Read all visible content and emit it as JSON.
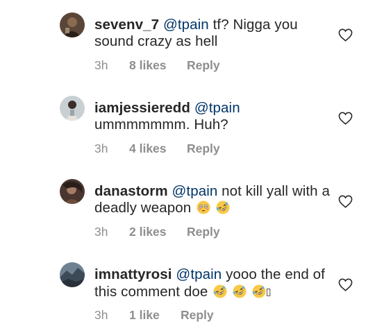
{
  "comments": [
    {
      "username": "sevenv_7",
      "mention": "@tpain",
      "text": " tf? Nigga you sound crazy as hell",
      "time": "3h",
      "likes": "8 likes",
      "reply": "Reply",
      "avatar_colors": [
        "#3a2a22",
        "#8a6a50",
        "#c9b39a"
      ]
    },
    {
      "username": "iamjessieredd",
      "mention": "@tpain",
      "text": " ummmmmmm. Huh?",
      "time": "3h",
      "likes": "4 likes",
      "reply": "Reply",
      "avatar_colors": [
        "#b9c3c9",
        "#e6e3df",
        "#3b2d28"
      ]
    },
    {
      "username": "danastorm",
      "mention": "@tpain",
      "text": " not kill yall with a deadly weapon",
      "time": "3h",
      "likes": "2 likes",
      "reply": "Reply",
      "emojis": [
        "flushed-face-emoji",
        "rolling-on-floor-laughing-emoji"
      ],
      "avatar_colors": [
        "#2b1f1c",
        "#6e4c3d",
        "#a57c65"
      ]
    },
    {
      "username": "imnattyrosi",
      "mention": "@tpain",
      "text": " yooo the end of this comment doe",
      "time": "3h",
      "likes": "1 like",
      "reply": "Reply",
      "emojis": [
        "rolling-on-floor-laughing-emoji",
        "rolling-on-floor-laughing-emoji",
        "rolling-on-floor-laughing-emoji"
      ],
      "trailing_glyph": "▯",
      "avatar_colors": [
        "#3c4a58",
        "#6f8291",
        "#28313a"
      ]
    }
  ],
  "icons": {
    "like": "heart-outline-icon"
  },
  "colors": {
    "text": "#262626",
    "mention": "#003569",
    "meta": "#8e8e8e",
    "heart_stroke": "#262626"
  }
}
